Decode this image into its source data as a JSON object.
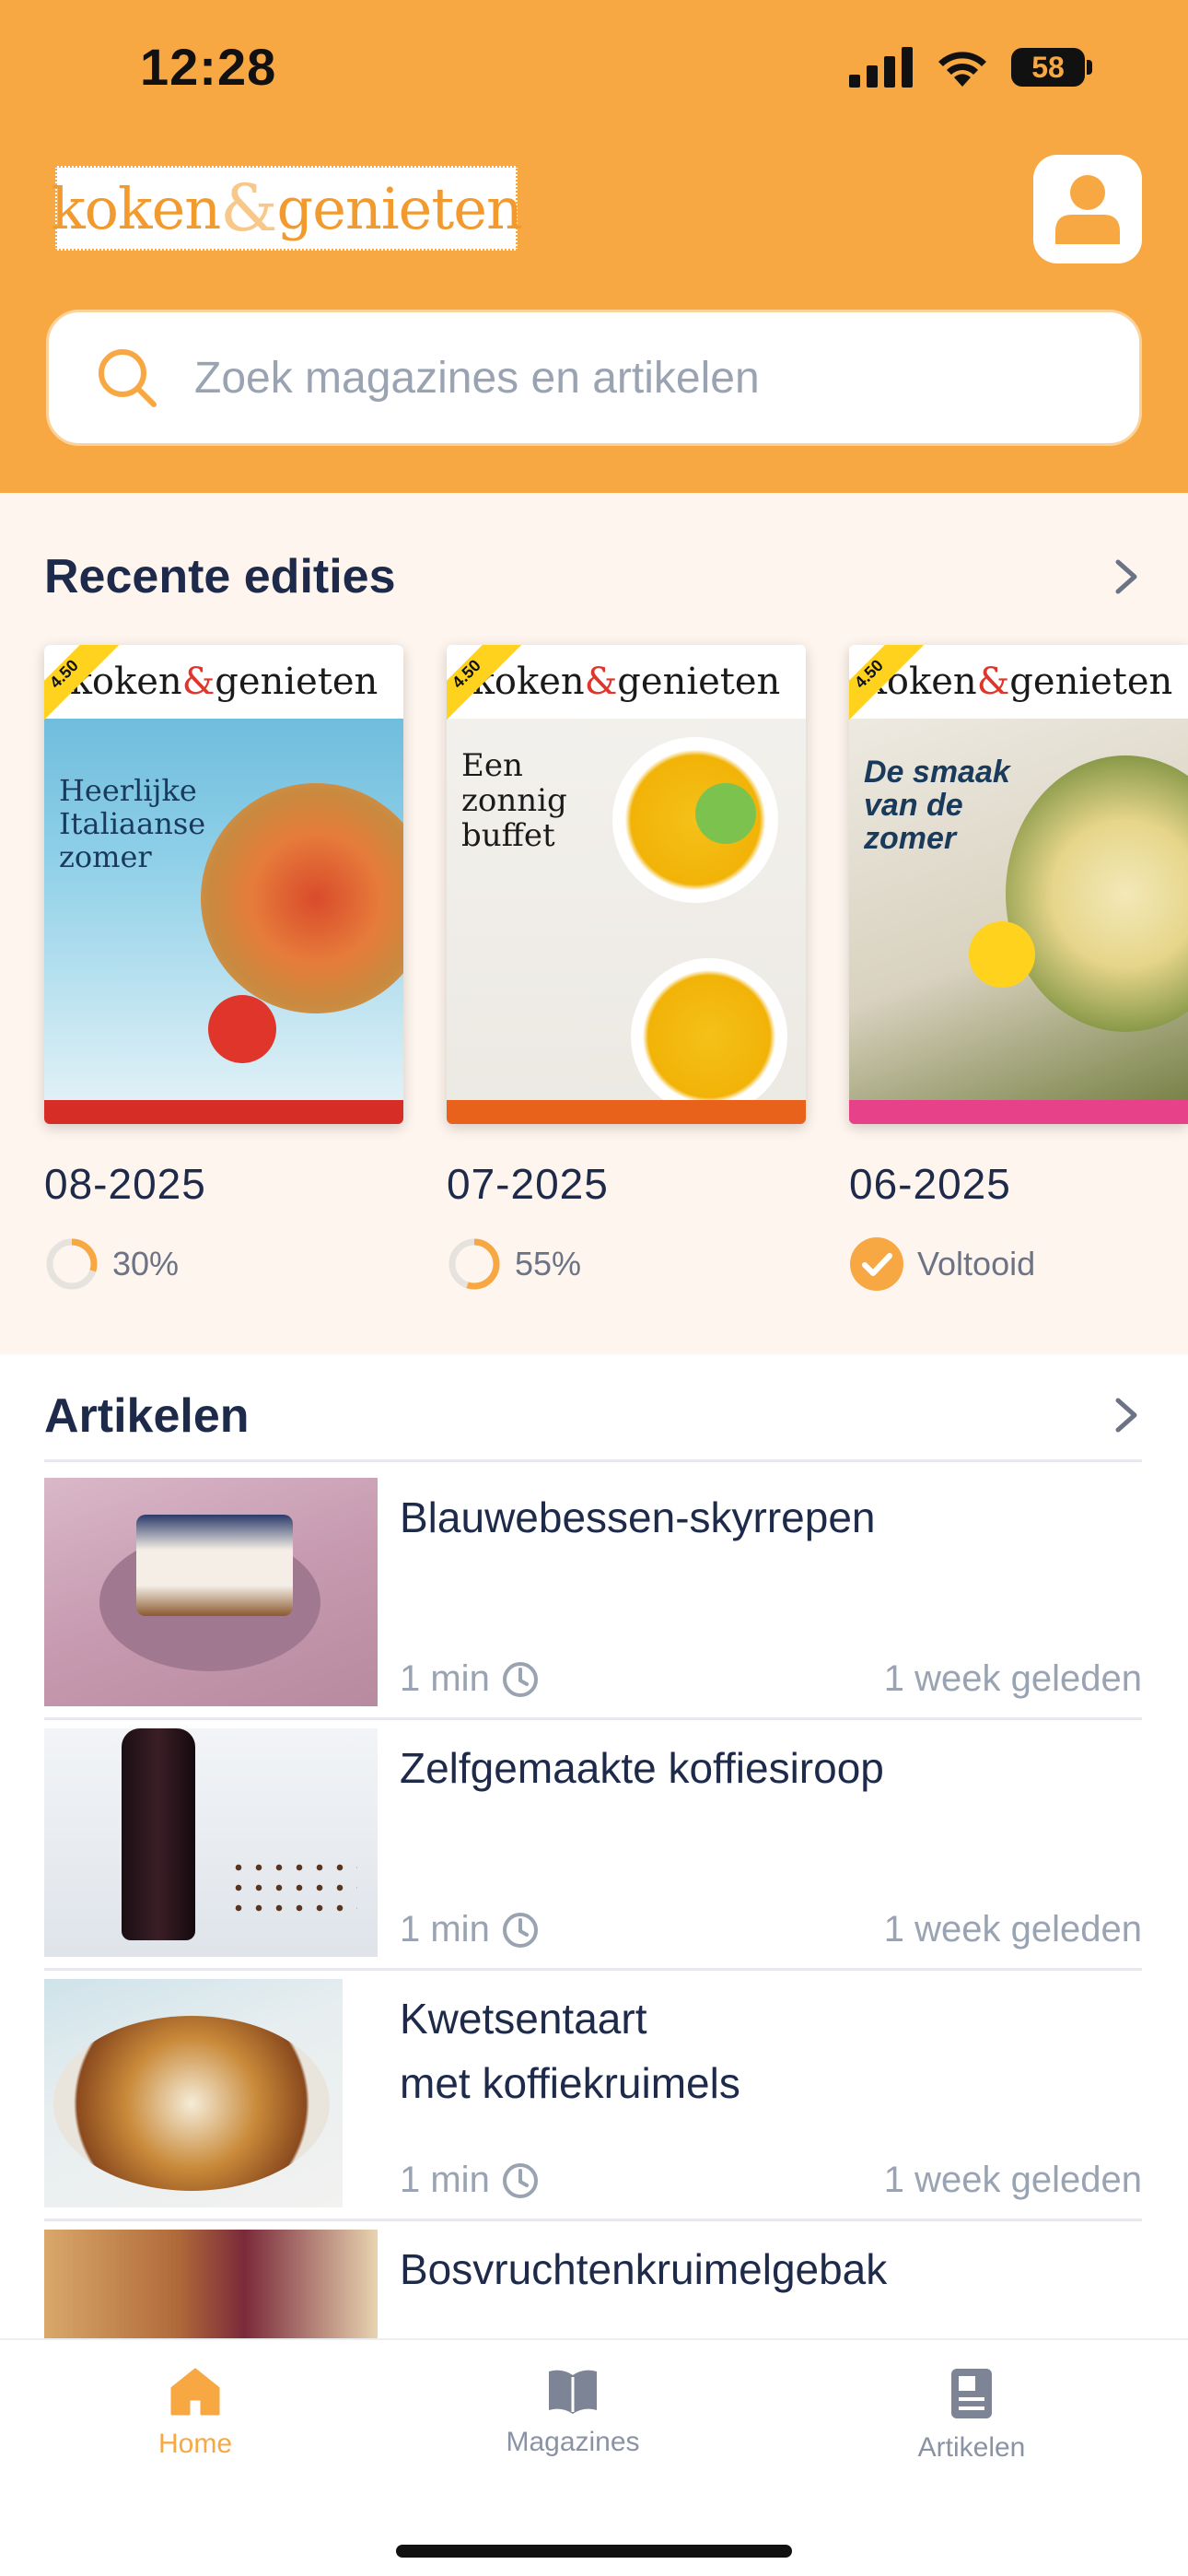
{
  "status": {
    "time": "12:28",
    "battery": "58"
  },
  "header": {
    "logo_left": "koken",
    "logo_amp": "&",
    "logo_right": "genieten",
    "search_placeholder": "Zoek magazines en artikelen"
  },
  "editions": {
    "title": "Recente edities",
    "items": [
      {
        "date": "08-2025",
        "progress": "30%",
        "progress_value": 0.3,
        "completed": false,
        "cover_headline": "Heerlijke Italiaanse zomer",
        "price": "4.50"
      },
      {
        "date": "07-2025",
        "progress": "55%",
        "progress_value": 0.55,
        "completed": false,
        "cover_headline": "Een zonnig buffet",
        "price": "4.50"
      },
      {
        "date": "06-2025",
        "progress": "Voltooid",
        "progress_value": 1.0,
        "completed": true,
        "cover_headline": "De smaak van de zomer",
        "price": "4.50"
      }
    ]
  },
  "articles": {
    "title": "Artikelen",
    "items": [
      {
        "title": "Blauwebessen-skyrrepen",
        "read_time": "1 min",
        "ago": "1 week geleden"
      },
      {
        "title": "Zelfgemaakte koffiesiroop",
        "read_time": "1 min",
        "ago": "1 week geleden"
      },
      {
        "title_line1": "Kwetsentaart",
        "title_line2": "met koffiekruimels",
        "read_time": "1 min",
        "ago": "1 week geleden"
      },
      {
        "title": "Bosvruchtenkruimelgebak"
      }
    ]
  },
  "tabs": [
    {
      "label": "Home",
      "active": true
    },
    {
      "label": "Magazines",
      "active": false
    },
    {
      "label": "Artikelen",
      "active": false
    }
  ],
  "colors": {
    "accent": "#f8a843",
    "navy": "#1e2a4a",
    "muted": "#9aa3b2",
    "cream": "#fef5ee"
  }
}
